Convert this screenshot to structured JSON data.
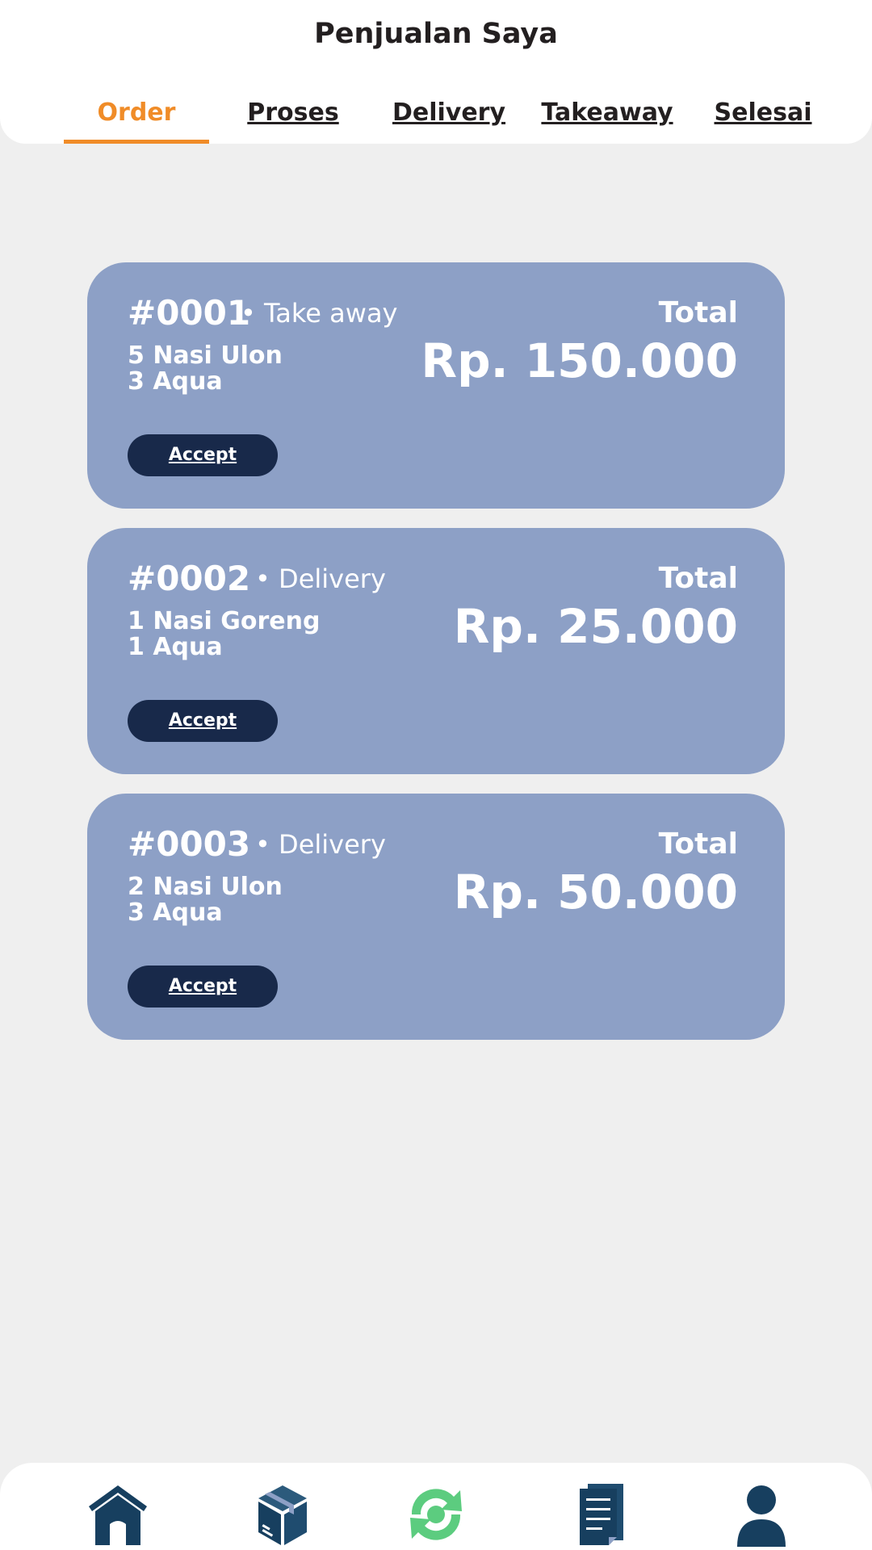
{
  "header": {
    "title": "Penjualan Saya",
    "tabs": [
      {
        "label": "Order",
        "active": true
      },
      {
        "label": "Proses",
        "active": false
      },
      {
        "label": "Delivery",
        "active": false
      },
      {
        "label": "Takeaway",
        "active": false
      },
      {
        "label": "Selesai",
        "active": false
      }
    ]
  },
  "orders": [
    {
      "id": "#0001",
      "type": "• Take away",
      "items": [
        "5 Nasi Ulon",
        "3 Aqua"
      ],
      "total_label": "Total",
      "total": "Rp. 150.000",
      "action": "Accept"
    },
    {
      "id": "#0002",
      "type": "• Delivery",
      "items": [
        "1 Nasi Goreng",
        "1 Aqua"
      ],
      "total_label": "Total",
      "total": "Rp. 25.000",
      "action": "Accept"
    },
    {
      "id": "#0003",
      "type": "• Delivery",
      "items": [
        "2 Nasi Ulon",
        "3 Aqua"
      ],
      "total_label": "Total",
      "total": "Rp. 50.000",
      "action": "Accept"
    }
  ],
  "bottom_nav": {
    "items": [
      {
        "icon": "home-icon"
      },
      {
        "icon": "box-icon"
      },
      {
        "icon": "sync-icon"
      },
      {
        "icon": "document-icon"
      },
      {
        "icon": "profile-icon"
      }
    ]
  },
  "colors": {
    "accent": "#f08c28",
    "card": "#8da0c6",
    "button": "#18294a",
    "nav_icon": "#173f5f",
    "nav_icon_active": "#5ccc7f"
  }
}
